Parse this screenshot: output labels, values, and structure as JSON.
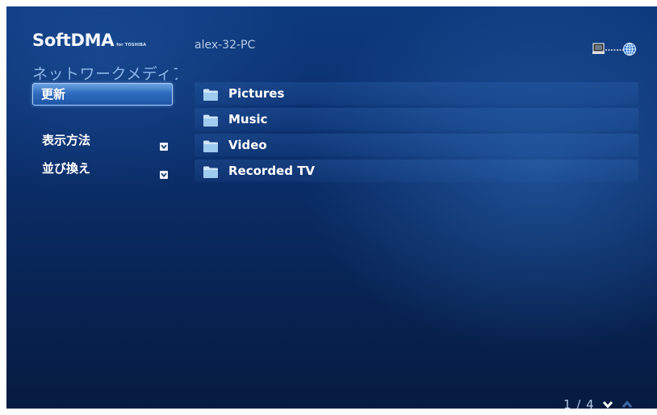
{
  "brand": {
    "name": "SoftDMA",
    "sub": "for TOSHIBA"
  },
  "header": {
    "pc_name": "alex-32-PC",
    "network_icon": "computer-network-globe-icon"
  },
  "sidebar": {
    "section_title": "ネットワークメディア",
    "refresh_label": "更新",
    "view_label": "表示方法",
    "sort_label": "並び換え",
    "chevron_icon": "chevron-down-icon"
  },
  "folders": [
    {
      "label": "Pictures",
      "icon": "folder-icon"
    },
    {
      "label": "Music",
      "icon": "folder-icon"
    },
    {
      "label": "Video",
      "icon": "folder-icon"
    },
    {
      "label": "Recorded TV",
      "icon": "folder-icon"
    }
  ],
  "pager": {
    "page_text": "1 / 4",
    "down_icon": "chevron-down-icon",
    "up_icon": "chevron-up-icon"
  },
  "colors": {
    "background_top": "#0d3a7e",
    "background_bottom": "#061b40",
    "selected_button": "#2f6cbf",
    "section_title": "#8cb5e8",
    "folder": "#a9d0f2"
  }
}
